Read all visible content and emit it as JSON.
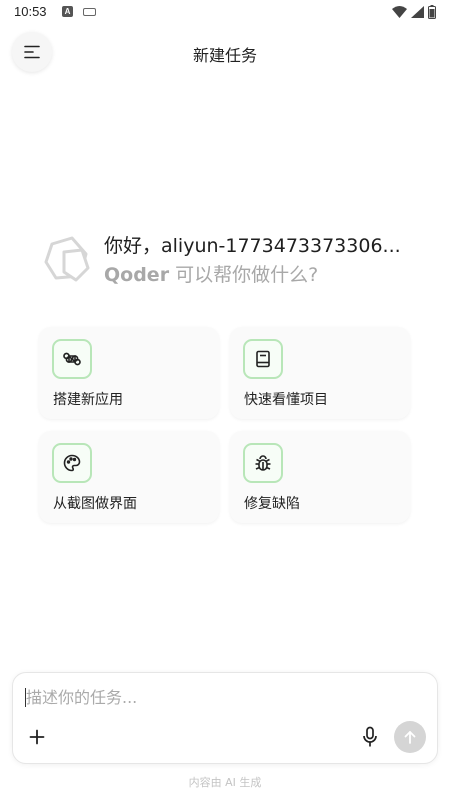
{
  "status_bar": {
    "time": "10:53",
    "notification_icons": [
      "android-icon",
      "keyboard-icon"
    ],
    "system_icons": [
      "wifi-icon",
      "signal-icon",
      "battery-icon"
    ]
  },
  "header": {
    "title": "新建任务",
    "menu_icon": "menu-icon"
  },
  "greeting": {
    "line1": "你好，aliyun-1773473373306...",
    "brand": "Qoder",
    "line2_rest": " 可以帮你做什么?"
  },
  "cards": [
    {
      "label": "搭建新应用",
      "icon": "command-icon"
    },
    {
      "label": "快速看懂项目",
      "icon": "book-icon"
    },
    {
      "label": "从截图做界面",
      "icon": "palette-icon"
    },
    {
      "label": "修复缺陷",
      "icon": "bug-icon"
    }
  ],
  "input": {
    "placeholder": "描述你的任务...",
    "value": ""
  },
  "footer": {
    "note": "内容由 AI 生成"
  },
  "colors": {
    "accent_border": "#b8e6b8",
    "send_button": "#d5d5d5",
    "muted_text": "#a8a8a8"
  }
}
